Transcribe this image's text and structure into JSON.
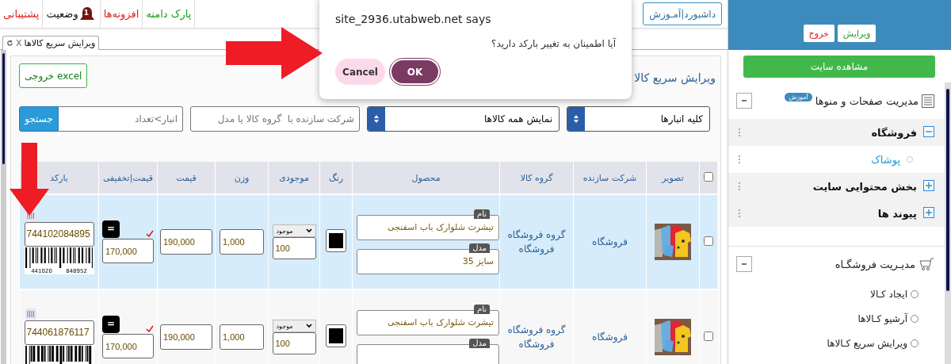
{
  "topbar": {
    "links": [
      {
        "label": "پارک دامنه",
        "color": "#1a9a1a"
      },
      {
        "label": "افزونه‌ها",
        "color": "#e02020"
      },
      {
        "label": "وضعیت",
        "color": "#111111",
        "badge": "1"
      },
      {
        "label": "پشتیبانی",
        "color": "#e02020"
      }
    ],
    "dashboard_button": "داشبورد|آمـوزش"
  },
  "tab": {
    "label": "ویرایش سریع کالاها",
    "close": "X"
  },
  "panel": {
    "title": "ویرایش سریع کالا",
    "excel_button": "خروجی excel"
  },
  "filters": {
    "search_button": "جستجو",
    "stock_field": {
      "placeholder": "انبار>تعداد"
    },
    "text_field": {
      "placeholder": "شرکت سازنده با  گروه کالا یا مدل"
    },
    "selects": [
      {
        "value": "کلیه انبارها"
      },
      {
        "value": "نمایش همه کالاها"
      }
    ]
  },
  "table": {
    "header_checked": false,
    "columns": [
      "تصویر",
      "شرکت سازنده",
      "گروه کالا",
      "محصول",
      "رنگ",
      "موجودی",
      "وزن",
      "قیمت",
      "قیمت|تخفیفی",
      "بارکد"
    ],
    "rows": [
      {
        "highlighted": true,
        "checked": false,
        "maker": "فروشگاه",
        "group": "گروه فروشگاه فروشگاه",
        "name_label": "نام",
        "name": "تیشرت شلوارک باب اسفنجی",
        "model_label": "مدل",
        "model": "سایز 35",
        "color": "#000000",
        "stock_status": "موجود",
        "stock": "100",
        "weight": "1,000",
        "price": "190,000",
        "discount_op": "=",
        "discount": "170,000",
        "barcode": "744102084895",
        "barcode_numbers": [
          "848952",
          "441020"
        ]
      },
      {
        "highlighted": false,
        "checked": false,
        "maker": "فروشگاه",
        "group": "گروه فروشگاه فروشگاه",
        "name_label": "نام",
        "name": "تیشرت شلوارک باب اسفنجی",
        "model_label": "مدل",
        "color": "#000000",
        "stock_status": "موجود",
        "stock": "100",
        "weight": "1,000",
        "price": "190,000",
        "discount_op": "=",
        "discount": "170,000",
        "barcode": "744061876117"
      }
    ]
  },
  "dialog": {
    "title": "site_2936.utabweb.net says",
    "message": "آیا اطمینان به تغییر بارکد دارید؟",
    "buttons": [
      {
        "label": "OK",
        "kind": "primary"
      },
      {
        "label": "Cancel",
        "kind": "secondary"
      }
    ]
  },
  "sidebar": {
    "header_buttons": [
      {
        "label": "ویرایش",
        "kind": "edit"
      },
      {
        "label": "خروج",
        "kind": "exit"
      }
    ],
    "view_site": "مشاهده سایت",
    "sections": [
      {
        "title": "مدیریت صفحات و منوها",
        "badge": "آموزش",
        "expanded": true,
        "tree": [
          {
            "label": "فروشگاه",
            "expanded": true,
            "children": [
              {
                "label": "پوشاک"
              }
            ]
          },
          {
            "label": "بخش محتوایی سایت",
            "expanded": false
          },
          {
            "label": "پیوند ها",
            "expanded": false
          }
        ]
      },
      {
        "title": "مدیـریت فروشگـاه",
        "expanded": true,
        "items": [
          "ایجاد کـالا",
          "آرشیو کـالاها",
          "ویرایش سریع کـالاها"
        ]
      }
    ]
  }
}
